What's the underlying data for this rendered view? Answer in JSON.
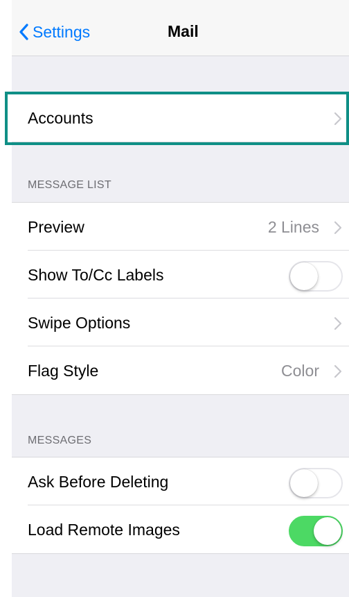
{
  "nav": {
    "back_label": "Settings",
    "title": "Mail"
  },
  "accounts": {
    "label": "Accounts"
  },
  "message_list": {
    "header": "MESSAGE LIST",
    "rows": [
      {
        "label": "Preview",
        "value": "2 Lines"
      },
      {
        "label": "Show To/Cc Labels",
        "toggle": "off"
      },
      {
        "label": "Swipe Options"
      },
      {
        "label": "Flag Style",
        "value": "Color"
      }
    ]
  },
  "messages": {
    "header": "MESSAGES",
    "rows": [
      {
        "label": "Ask Before Deleting",
        "toggle": "off"
      },
      {
        "label": "Load Remote Images",
        "toggle": "on"
      }
    ]
  },
  "colors": {
    "accent": "#007aff",
    "toggle_on": "#4cd964",
    "highlight": "#0f8f86",
    "background": "#efeff4"
  },
  "icons": {
    "back": "chevron-left-icon",
    "disclosure": "chevron-right-icon"
  }
}
